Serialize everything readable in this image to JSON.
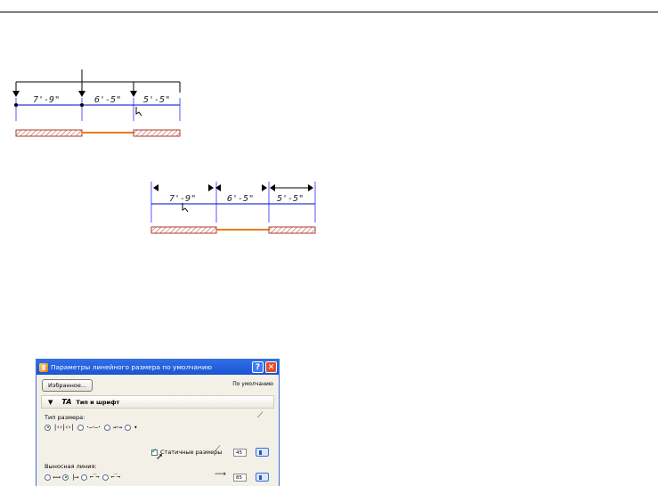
{
  "drawing1": {
    "dims": [
      "7'-9\"",
      "6'-5\"",
      "5'-5\""
    ],
    "colors": {
      "line": "#0000cc",
      "wall": "#b03a2e",
      "opening": "#e87b1e",
      "witness": "#5555ff"
    }
  },
  "drawing2": {
    "dims": [
      "7'-9\"",
      "6'-5\"",
      "5'-5\""
    ]
  },
  "dialog": {
    "title": "Параметры линейного размера по умолчанию",
    "help_glyph": "?",
    "close_glyph": "✕",
    "favorites_label": "Избранное...",
    "default_label": "По умолчанию",
    "panel_title": "Тип и шрифт",
    "panel_icon": "TA",
    "dim_type_label": "Тип размера:",
    "static_dims_label": "Статичные размеры",
    "witness_line_label": "Выносная линия:",
    "value_1": "45",
    "value_2": "85",
    "accent": "#1c54d2"
  }
}
